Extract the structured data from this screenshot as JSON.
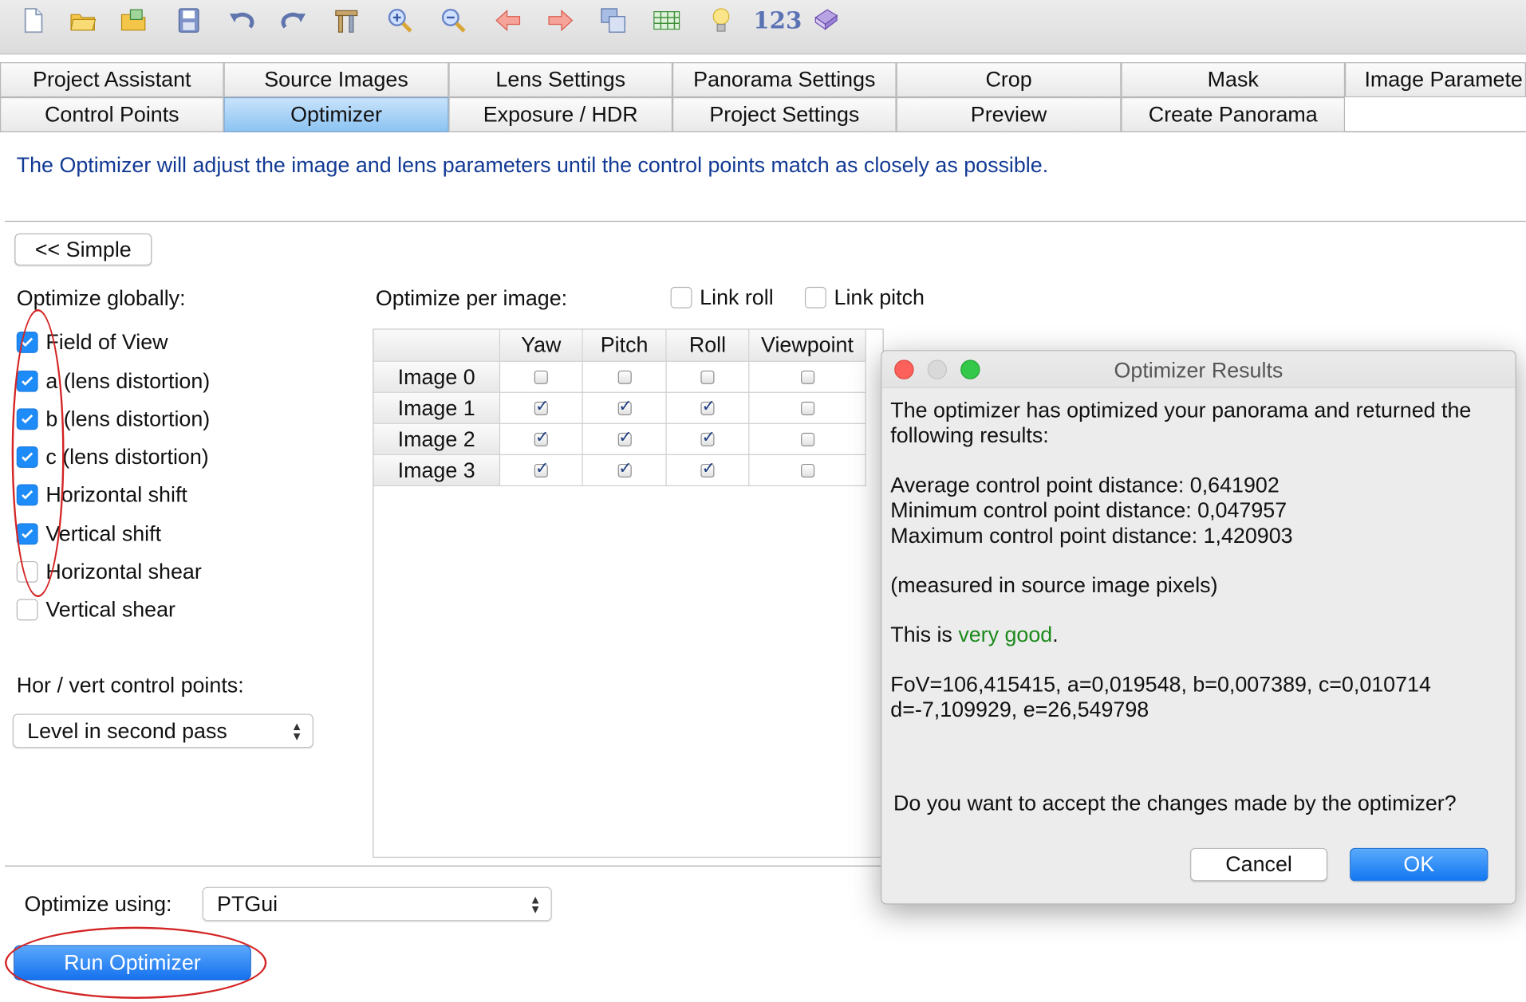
{
  "toolbar": {
    "icons": [
      "new-file-icon",
      "open-folder-icon",
      "open-images-icon",
      "save-icon",
      "undo-icon",
      "redo-icon",
      "tools-icon",
      "zoom-in-icon",
      "zoom-out-icon",
      "back-arrow-icon",
      "forward-arrow-icon",
      "panorama-icon",
      "table-icon",
      "lightbulb-icon",
      "numbers-icon",
      "book-icon"
    ],
    "numbers_label": "123"
  },
  "tabs": {
    "row1": [
      "Project Assistant",
      "Source Images",
      "Lens Settings",
      "Panorama Settings",
      "Crop",
      "Mask",
      "Image Paramete"
    ],
    "row2": [
      "Control Points",
      "Optimizer",
      "Exposure / HDR",
      "Project Settings",
      "Preview",
      "Create Panorama"
    ],
    "active": "Optimizer"
  },
  "intro": "The Optimizer will adjust the image and lens parameters until the control points match as closely as possible.",
  "simple_button": "<< Simple",
  "optimize_globally": {
    "heading": "Optimize globally:",
    "options": [
      {
        "label": "Field of View",
        "checked": true
      },
      {
        "label": "a (lens distortion)",
        "checked": true
      },
      {
        "label": "b (lens distortion)",
        "checked": true
      },
      {
        "label": "c (lens distortion)",
        "checked": true
      },
      {
        "label": "Horizontal shift",
        "checked": true
      },
      {
        "label": "Vertical shift",
        "checked": true
      },
      {
        "label": "Horizontal shear",
        "checked": false
      },
      {
        "label": "Vertical shear",
        "checked": false
      }
    ]
  },
  "hor_vert": {
    "heading": "Hor / vert control points:",
    "value": "Level in second pass"
  },
  "per_image": {
    "heading": "Optimize per image:",
    "link_roll": "Link roll",
    "link_pitch": "Link pitch",
    "columns": [
      "Yaw",
      "Pitch",
      "Roll",
      "Viewpoint"
    ],
    "rows": [
      {
        "label": "Image 0",
        "checks": [
          false,
          false,
          false,
          false
        ]
      },
      {
        "label": "Image 1",
        "checks": [
          true,
          true,
          true,
          false
        ]
      },
      {
        "label": "Image 2",
        "checks": [
          true,
          true,
          true,
          false
        ]
      },
      {
        "label": "Image 3",
        "checks": [
          true,
          true,
          true,
          false
        ]
      }
    ]
  },
  "optimize_using": {
    "label": "Optimize using:",
    "value": "PTGui"
  },
  "run_button": "Run Optimizer",
  "dialog": {
    "title": "Optimizer Results",
    "line1": "The optimizer has optimized your panorama and returned the",
    "line2": "following results:",
    "avg": "Average control point distance: 0,641902",
    "min": "Minimum control point distance: 0,047957",
    "max": "Maximum control point distance: 1,420903",
    "measured": "(measured in source image pixels)",
    "quality_prefix": "This is ",
    "quality_value": "very good",
    "quality_suffix": ".",
    "params1": "FoV=106,415415, a=0,019548, b=0,007389, c=0,010714",
    "params2": "d=-7,109929, e=26,549798",
    "question": "Do you want to accept the changes made by the optimizer?",
    "cancel": "Cancel",
    "ok": "OK"
  },
  "colors": {
    "accent": "#1d8cf8",
    "intro_text": "#123a94",
    "annotation": "#d42424",
    "good": "#1c8a1c"
  }
}
